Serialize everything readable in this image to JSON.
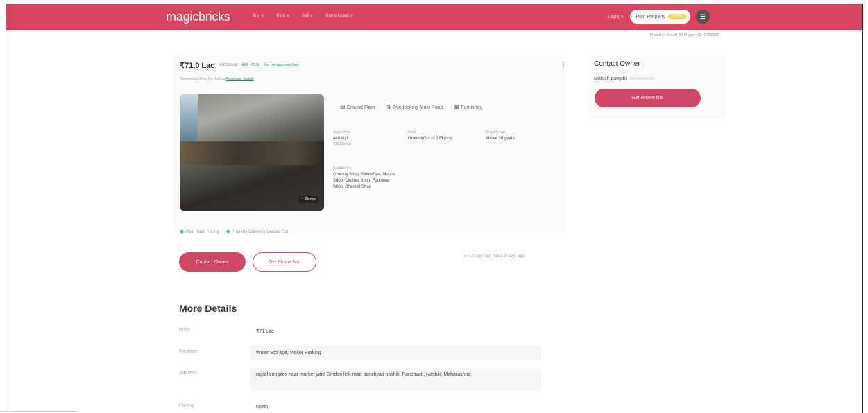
{
  "header": {
    "logo": "magicbricks",
    "nav": [
      "Buy ∨",
      "Rent ∨",
      "Sell ∨",
      "Home Loans ∨"
    ],
    "login": "Login ∨",
    "post_property": "Post Property",
    "free_badge": "FREE",
    "menu_icon": "hamburger-icon"
  },
  "posted_info": "Posted on Dec 08 '24    Property ID: 67958088",
  "listing": {
    "price": "₹71.0 Lac",
    "price_per_sqft": "₹16136/sqft",
    "emi": "EMI - ₹3.0k",
    "home_loan_link": "Get pre-approved loan",
    "breadcrumb_prefix": "Commercial Shop For Sale in",
    "breadcrumb_link": "Panchvati, Nashik",
    "photo_count": "1 Photos",
    "features": [
      "Ground Floor",
      "Overlooking Main Road",
      "Furnished"
    ],
    "specs": {
      "super_area_label": "Super Area",
      "super_area_value": "440 sqft",
      "super_area_sub": "₹16136/sqft",
      "floor_label": "Floor",
      "floor_value": "Ground(Out of 2 Floors)",
      "age_label": "Property age",
      "age_value": "Above 20 years",
      "suitable_label": "Suitable For",
      "suitable_value": "Grocery Shop, Salon/Spa, Mobile Shop, Clothes Shop, Footwear Shop, Chemist Shop"
    },
    "tags": [
      "Main Road Facing",
      "Property Currently Leased Out"
    ],
    "contact_button": "Contact Owner",
    "phone_button": "Get Phone No.",
    "last_contact": "Last contact made 3 days ago"
  },
  "more_details": {
    "title": "More Details",
    "rows": [
      {
        "label": "Price",
        "value": "₹71 Lac"
      },
      {
        "label": "Facilities",
        "value": "Water Storage, Visitor Parking"
      },
      {
        "label": "Address",
        "value": "rajpal complex near market yard Dindori link road panchvati nashik, Panchvati, Nashik, Maharashtra"
      },
      {
        "label": "Facing",
        "value": "North"
      }
    ]
  },
  "owner": {
    "title": "Contact Owner",
    "name": "Manish punjabi",
    "phone_masked": "+91-XXXXXXXX",
    "phone_button": "Get Phone No."
  }
}
